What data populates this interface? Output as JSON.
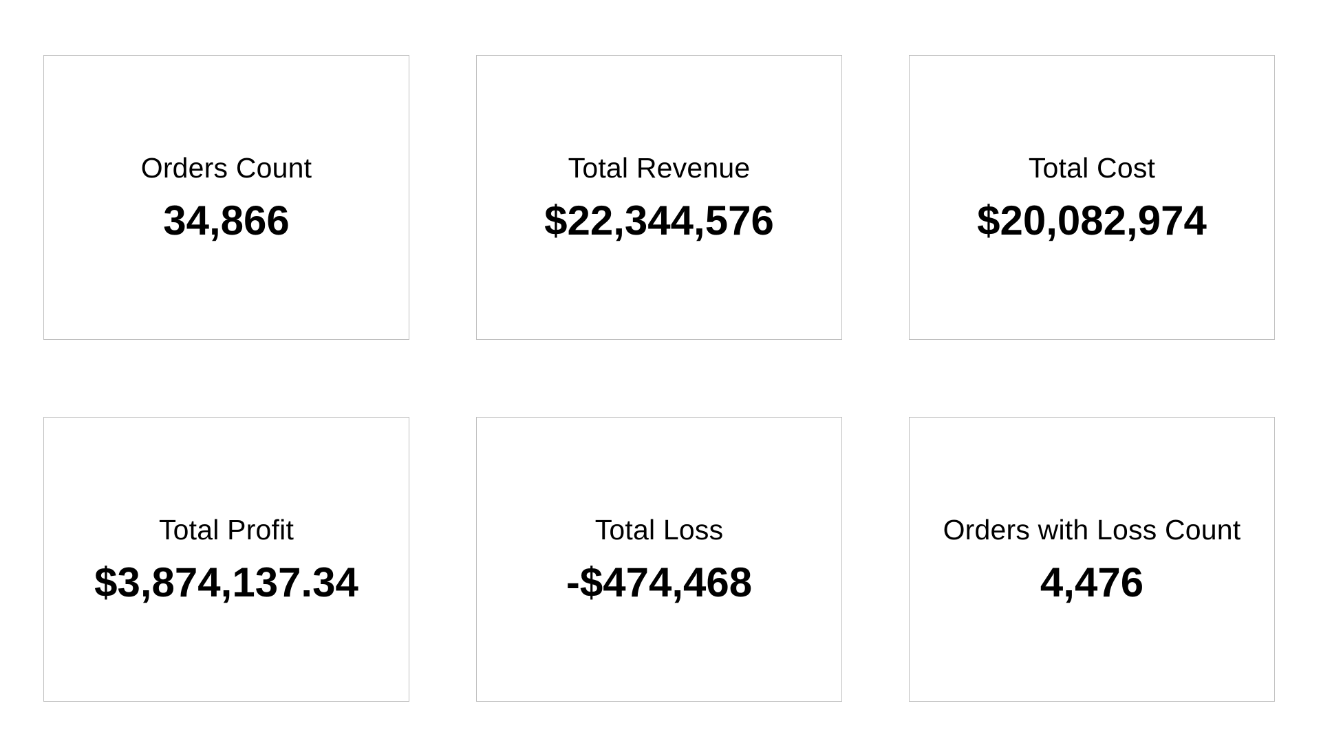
{
  "cards": [
    {
      "label": "Orders Count",
      "value": "34,866"
    },
    {
      "label": "Total Revenue",
      "value": "$22,344,576"
    },
    {
      "label": "Total Cost",
      "value": "$20,082,974"
    },
    {
      "label": "Total Profit",
      "value": "$3,874,137.34"
    },
    {
      "label": "Total Loss",
      "value": "-$474,468"
    },
    {
      "label": "Orders with Loss Count",
      "value": "4,476"
    }
  ]
}
